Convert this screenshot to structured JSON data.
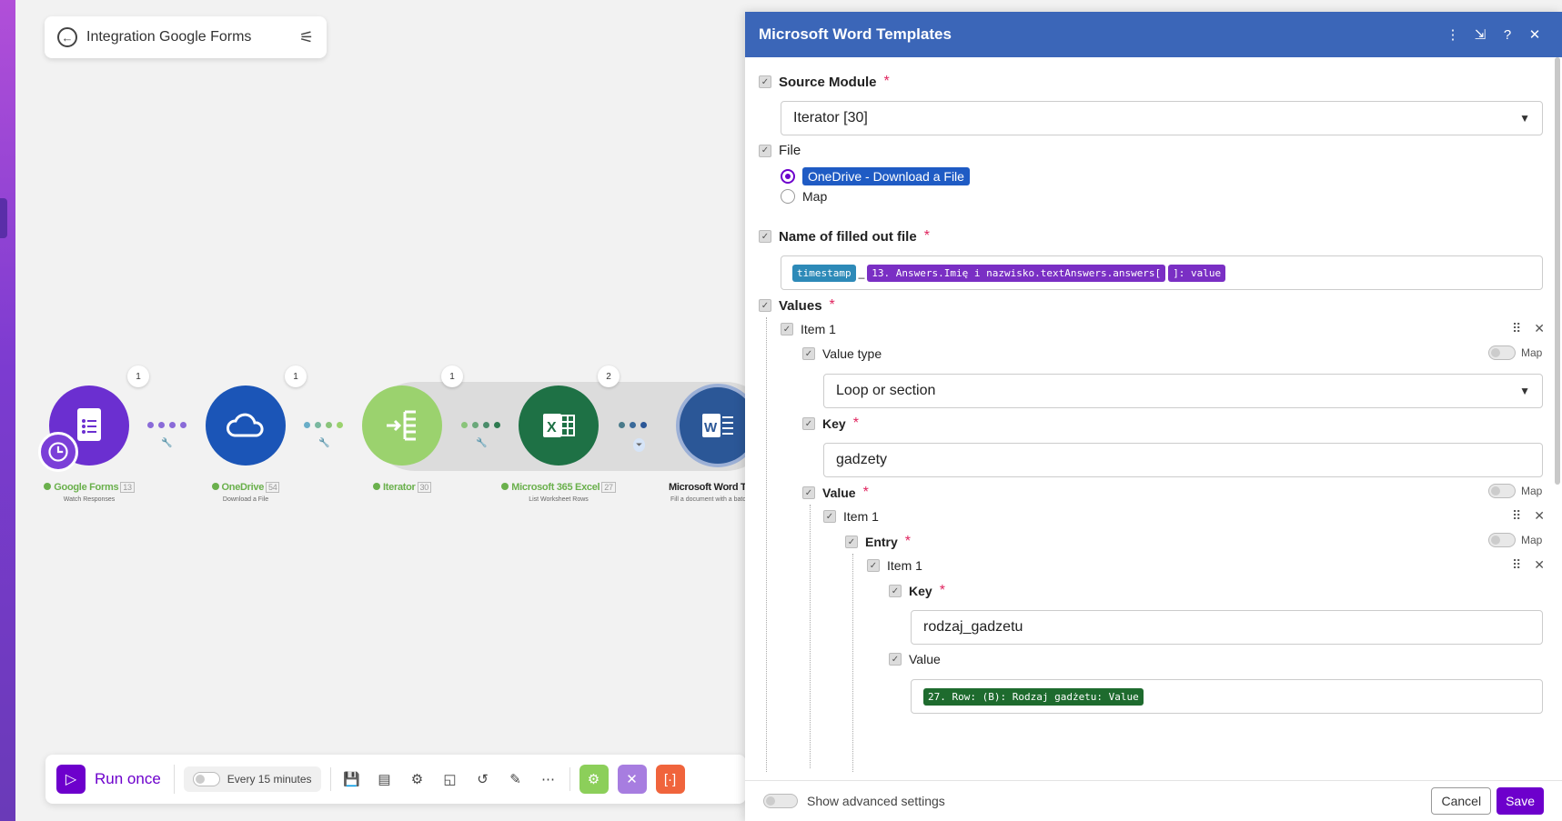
{
  "scenario": {
    "title": "Integration Google Forms"
  },
  "modules": [
    {
      "name": "Google Forms",
      "id": "13",
      "subtitle": "Watch Responses",
      "badge": "1",
      "color": "#6b2fd0"
    },
    {
      "name": "OneDrive",
      "id": "54",
      "subtitle": "Download a File",
      "badge": "1",
      "color": "#1b55b7"
    },
    {
      "name": "Iterator",
      "id": "30",
      "subtitle": "",
      "badge": "1",
      "color": "#9bd26e"
    },
    {
      "name": "Microsoft 365 Excel",
      "id": "27",
      "subtitle": "List Worksheet Rows",
      "badge": "2",
      "color": "#1e7145"
    },
    {
      "name": "Microsoft Word Te",
      "id": "",
      "subtitle": "Fill a document with a batch",
      "badge": "",
      "color": "#2b5797"
    }
  ],
  "toolbar": {
    "run_label": "Run once",
    "schedule_label": "Every 15 minutes"
  },
  "panel": {
    "title": "Microsoft Word Templates",
    "source_module": {
      "label": "Source Module",
      "value": "Iterator [30]"
    },
    "file": {
      "label": "File",
      "option_selected": "OneDrive - Download a File",
      "option_map": "Map"
    },
    "filled_name": {
      "label": "Name of filled out file",
      "pills": [
        {
          "text": "timestamp",
          "color": "#2d8ab8"
        },
        {
          "text": "_",
          "color": ""
        },
        {
          "text": "13. Answers.Imię i nazwisko.textAnswers.answers[",
          "color": "#7a2fc4"
        },
        {
          "text": "]: value",
          "color": "#7a2fc4"
        }
      ]
    },
    "values": {
      "label": "Values",
      "item1_label": "Item 1",
      "value_type": {
        "label": "Value type",
        "value": "Loop or section",
        "map": "Map"
      },
      "key": {
        "label": "Key",
        "value": "gadzety"
      },
      "value": {
        "label": "Value",
        "map": "Map"
      },
      "inner_item_label": "Item 1",
      "entry": {
        "label": "Entry",
        "map": "Map"
      },
      "entry_item_label": "Item 1",
      "entry_key": {
        "label": "Key",
        "value": "rodzaj_gadzetu"
      },
      "entry_value": {
        "label": "Value",
        "pill": "27. Row: (B): Rodzaj gadżetu: Value",
        "pill_color": "#1e6b2e"
      }
    },
    "footer": {
      "advanced": "Show advanced settings",
      "cancel": "Cancel",
      "save": "Save"
    }
  }
}
